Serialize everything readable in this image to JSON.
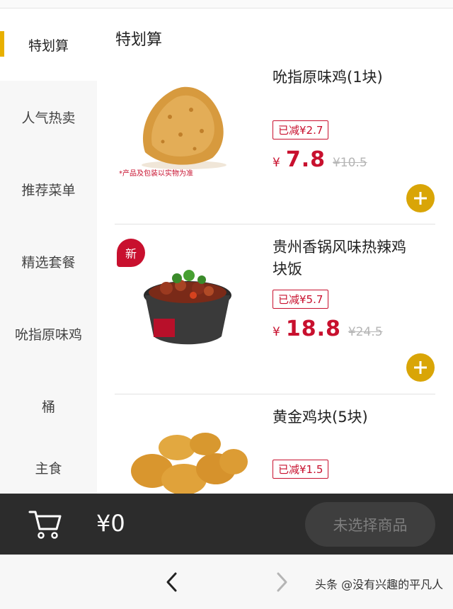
{
  "sidebar": {
    "items": [
      {
        "label": "特划算"
      },
      {
        "label": "人气热卖"
      },
      {
        "label": "推荐菜单"
      },
      {
        "label": "精选套餐"
      },
      {
        "label": "吮指原味鸡"
      },
      {
        "label": "桶"
      },
      {
        "label": "主食"
      }
    ]
  },
  "main": {
    "section_title": "特划算",
    "products": [
      {
        "name": "吮指原味鸡(1块)",
        "discount": "已减¥2.7",
        "currency": "¥",
        "price": "7.8",
        "original_price": "¥10.5",
        "footnote": "*产品及包装以实物为准"
      },
      {
        "name": "贵州香锅风味热辣鸡块饭",
        "discount": "已减¥5.7",
        "currency": "¥",
        "price": "18.8",
        "original_price": "¥24.5",
        "tag": "新"
      },
      {
        "name": "黄金鸡块(5块)",
        "discount": "已减¥1.5"
      }
    ]
  },
  "cart": {
    "total": "¥0",
    "checkout_label": "未选择商品"
  },
  "watermark": "头条 @没有兴趣的平凡人",
  "colors": {
    "accent": "#d9a507",
    "price": "#c8102e",
    "bar": "#2c2c2c"
  }
}
